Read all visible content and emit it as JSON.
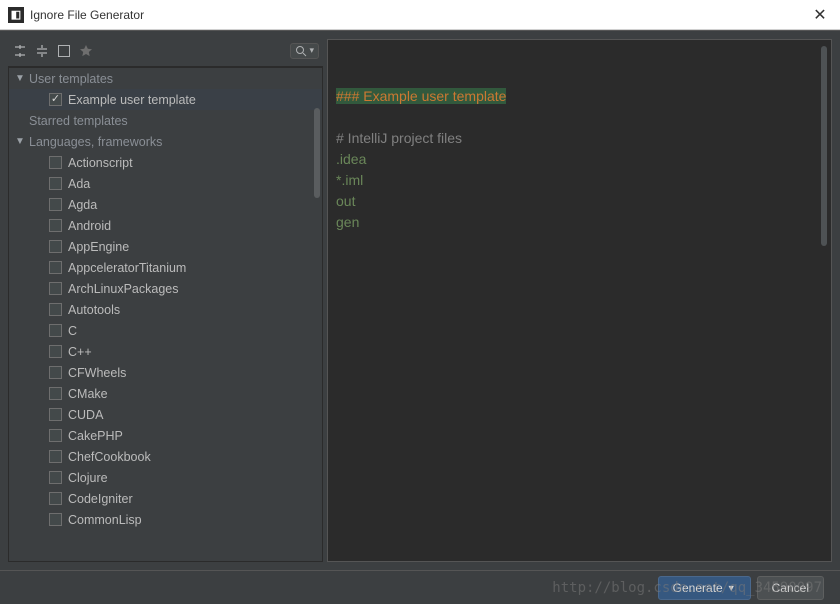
{
  "window": {
    "title": "Ignore File Generator"
  },
  "toolbar": {
    "icons": [
      "expand-all",
      "collapse-all",
      "select-all",
      "star"
    ],
    "search_placeholder": "Q"
  },
  "tree": {
    "groups": [
      {
        "label": "User templates",
        "expanded": true,
        "items": [
          {
            "label": "Example user template",
            "checked": true,
            "selected": true
          }
        ]
      },
      {
        "label": "Starred templates",
        "expanded": false,
        "items": []
      },
      {
        "label": "Languages, frameworks",
        "expanded": true,
        "items": [
          {
            "label": "Actionscript",
            "checked": false
          },
          {
            "label": "Ada",
            "checked": false
          },
          {
            "label": "Agda",
            "checked": false
          },
          {
            "label": "Android",
            "checked": false
          },
          {
            "label": "AppEngine",
            "checked": false
          },
          {
            "label": "AppceleratorTitanium",
            "checked": false
          },
          {
            "label": "ArchLinuxPackages",
            "checked": false
          },
          {
            "label": "Autotools",
            "checked": false
          },
          {
            "label": "C",
            "checked": false
          },
          {
            "label": "C++",
            "checked": false
          },
          {
            "label": "CFWheels",
            "checked": false
          },
          {
            "label": "CMake",
            "checked": false
          },
          {
            "label": "CUDA",
            "checked": false
          },
          {
            "label": "CakePHP",
            "checked": false
          },
          {
            "label": "ChefCookbook",
            "checked": false
          },
          {
            "label": "Clojure",
            "checked": false
          },
          {
            "label": "CodeIgniter",
            "checked": false
          },
          {
            "label": "CommonLisp",
            "checked": false
          }
        ]
      }
    ]
  },
  "editor": {
    "lines": [
      {
        "text": "### Example user template",
        "cls": "ed-heading"
      },
      {
        "text": "",
        "cls": ""
      },
      {
        "text": "# IntelliJ project files",
        "cls": "ed-comment"
      },
      {
        "text": ".idea",
        "cls": "ed-pattern"
      },
      {
        "text": "*.iml",
        "cls": "ed-pattern"
      },
      {
        "text": "out",
        "cls": "ed-pattern"
      },
      {
        "text": "gen",
        "cls": "ed-pattern"
      }
    ]
  },
  "footer": {
    "generate_label": "Generate",
    "cancel_label": "Cancel"
  },
  "watermark": "http://blog.csdn.net/qq_34590097"
}
